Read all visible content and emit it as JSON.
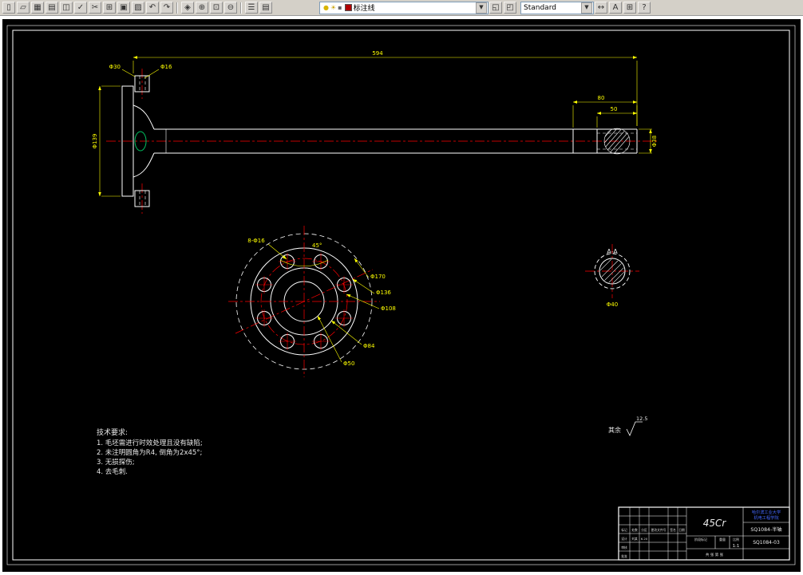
{
  "colors": {
    "background": "#000000",
    "geometry": "#ffffff",
    "dimension": "#ffff00",
    "centerline": "#ff0000",
    "school_text": "#4468ff",
    "fillet_highlight": "#00c060"
  },
  "toolbar": {
    "layer_combo": "标注线",
    "style_combo": "Standard",
    "groups": {
      "g1": [
        {
          "name": "new",
          "glyph": "▯"
        },
        {
          "name": "open",
          "glyph": "▱"
        },
        {
          "name": "save",
          "glyph": "▦"
        },
        {
          "name": "plot",
          "glyph": "▤"
        },
        {
          "name": "plot-preview",
          "glyph": "◫"
        },
        {
          "name": "spell-check",
          "glyph": "✓"
        },
        {
          "name": "cut",
          "glyph": "✂"
        },
        {
          "name": "copy",
          "glyph": "⊞"
        },
        {
          "name": "paste",
          "glyph": "▣"
        },
        {
          "name": "match-properties",
          "glyph": "▨"
        },
        {
          "name": "undo",
          "glyph": "↶"
        },
        {
          "name": "redo",
          "glyph": "↷"
        }
      ],
      "g2": [
        {
          "name": "pan",
          "glyph": "◈"
        },
        {
          "name": "zoom-realtime",
          "glyph": "⊕"
        },
        {
          "name": "zoom-window",
          "glyph": "⊡"
        },
        {
          "name": "zoom-previous",
          "glyph": "⊖"
        }
      ],
      "g3": [
        {
          "name": "layer-properties",
          "glyph": "☰"
        },
        {
          "name": "layer-states",
          "glyph": "▤"
        }
      ],
      "g4": [
        {
          "name": "make-object-layer-current",
          "glyph": "◱"
        },
        {
          "name": "layer-previous",
          "glyph": "◰"
        }
      ],
      "g5": [
        {
          "name": "dim-style",
          "glyph": "↔"
        },
        {
          "name": "text-style",
          "glyph": "A"
        },
        {
          "name": "table-style",
          "glyph": "⊞"
        },
        {
          "name": "help",
          "glyph": "?"
        }
      ]
    }
  },
  "drawing": {
    "shaft": {
      "dim_total": "594",
      "dim_step": "80",
      "dim_spline": "50",
      "dim_end_dia": "Φ38",
      "dim_flange_dia": "Φ139",
      "dim_boss_dia": "Φ30",
      "dim_boss_hole": "Φ16"
    },
    "flange_view": {
      "label_holes": "8-Φ16",
      "label_angle": "45°",
      "label_d_outer": "Φ170",
      "label_d_flange": "Φ136",
      "label_d_bolt": "Φ108",
      "label_d_hub": "Φ84",
      "label_d_bore": "Φ50"
    },
    "section_view": {
      "title": "A-A",
      "dim": "Φ40"
    },
    "finish": {
      "prefix": "其余",
      "value": "12.5"
    },
    "tech": {
      "title": "技术要求:",
      "lines": [
        "1. 毛坯需进行时效处理且没有缺陷;",
        "2. 未注明圆角为R4, 倒角为2x45°;",
        "3. 无损探伤;",
        "4. 去毛刺."
      ]
    },
    "title_block": {
      "material": "45Cr",
      "school_line1": "哈尔滨工业大学",
      "school_line2": "机电工程学院",
      "part_name": "SQ1084-半轴",
      "drawing_no": "SQ1084-03",
      "stage_label": "阶段标记",
      "weight_label": "重量",
      "scale_label": "比例",
      "scale_value": "1:1",
      "sheets": "共 张 第 张",
      "mark_label": "标记",
      "count_label": "处数",
      "zone_label": "分区",
      "file_label": "更改文件号",
      "sign_label": "签名",
      "date_label": "日期",
      "design_label": "设计",
      "design_name": "刘某",
      "design_date": "6.20",
      "check_label": "审核",
      "approve_label": "批准"
    }
  }
}
